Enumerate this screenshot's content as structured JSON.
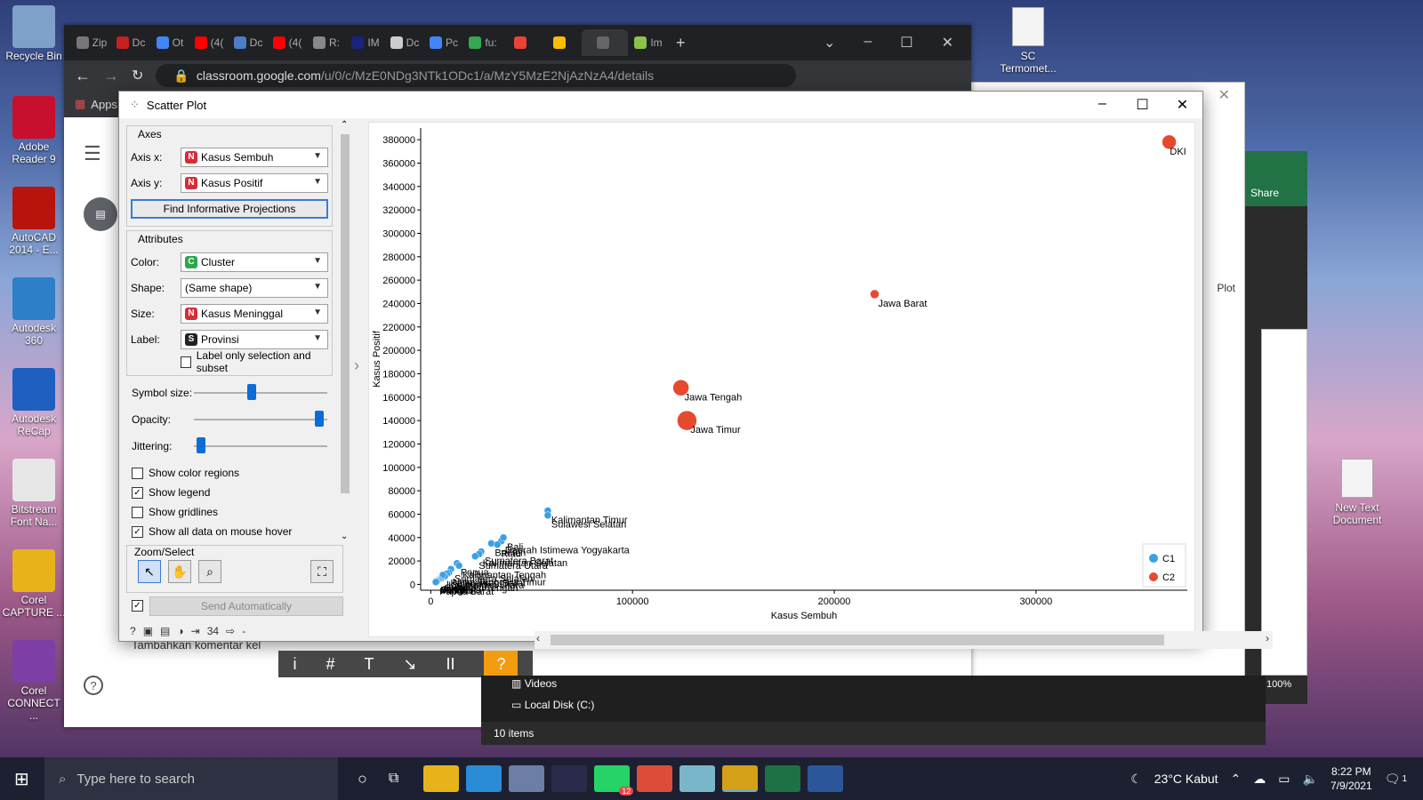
{
  "desktop_left": [
    {
      "label": "Recycle Bin",
      "top": 6,
      "color": "#7fa0c8"
    },
    {
      "label": "Adobe Reader 9",
      "top": 108,
      "color": "#c8102e"
    },
    {
      "label": "AutoCAD 2014 - E...",
      "top": 210,
      "color": "#b8140e"
    },
    {
      "label": "Autodesk 360",
      "top": 312,
      "color": "#2d7fc8"
    },
    {
      "label": "Autodesk ReCap",
      "top": 414,
      "color": "#1f5fbf"
    },
    {
      "label": "Bitstream Font Na...",
      "top": 516,
      "color": "#e6e6e6"
    },
    {
      "label": "Corel CAPTURE ...",
      "top": 618,
      "color": "#e8b31a"
    },
    {
      "label": "Corel CONNECT ...",
      "top": 720,
      "color": "#7d3fa6"
    }
  ],
  "desktop_right": {
    "sc": "SC Termomet...",
    "newtext": "New Text Document"
  },
  "browser": {
    "tabs": [
      "Zip",
      "Dc",
      "Ot",
      "(4(",
      "Dc",
      "(4(",
      "R:",
      "IM",
      "Dc",
      "Pc",
      "fu:",
      "",
      "",
      "",
      "Im"
    ],
    "url_main": "classroom.google.com",
    "url_rest": "/u/0/c/MzE0NDg3NTk1ODc1/a/MzY5MzE2NjAzNzA4/details",
    "apps": "Apps",
    "comment": "Tambahkan komentar kel"
  },
  "window": {
    "title": "Scatter Plot"
  },
  "axes": {
    "legend": "Axes",
    "x_label": "Axis x:",
    "x_value": "Kasus Sembuh",
    "y_label": "Axis y:",
    "y_value": "Kasus Positif",
    "find_button": "Find Informative Projections"
  },
  "attributes": {
    "legend": "Attributes",
    "color_label": "Color:",
    "color_value": "Cluster",
    "shape_label": "Shape:",
    "shape_value": "(Same shape)",
    "size_label": "Size:",
    "size_value": "Kasus Meninggal",
    "label_label": "Label:",
    "label_value": "Provinsi",
    "label_only": "Label only selection and subset"
  },
  "sliders": {
    "symbol_label": "Symbol size:",
    "symbol_level": 0.43,
    "opacity_label": "Opacity:",
    "opacity_level": 0.97,
    "jitter_label": "Jittering:",
    "jitter_level": 0.02
  },
  "checks": [
    {
      "label": "Show color regions",
      "checked": false
    },
    {
      "label": "Show legend",
      "checked": true
    },
    {
      "label": "Show gridlines",
      "checked": false
    },
    {
      "label": "Show all data on mouse hover",
      "checked": true
    }
  ],
  "zoom": {
    "legend": "Zoom/Select"
  },
  "send": {
    "label": "Send Automatically",
    "checked": true
  },
  "status": {
    "count": "34",
    "output": "-"
  },
  "chart_data": {
    "type": "scatter",
    "xlabel": "Kasus Sembuh",
    "ylabel": "Kasus Positif",
    "xlim": [
      -5000,
      375000
    ],
    "ylim": [
      -5000,
      390000
    ],
    "xticks": [
      "0",
      "100000",
      "200000",
      "300000"
    ],
    "yticks": [
      "0",
      "20000",
      "40000",
      "60000",
      "80000",
      "100000",
      "120000",
      "140000",
      "160000",
      "180000",
      "200000",
      "220000",
      "240000",
      "260000",
      "280000",
      "300000",
      "320000",
      "340000",
      "360000",
      "380000"
    ],
    "legend": [
      {
        "name": "C1",
        "color": "#3aa0e6"
      },
      {
        "name": "C2",
        "color": "#e64a2e"
      }
    ],
    "points": [
      {
        "label": "DKI",
        "x": 366000,
        "y": 378000,
        "cluster": "C2",
        "size": 8
      },
      {
        "label": "Jawa Barat",
        "x": 220000,
        "y": 248000,
        "cluster": "C2",
        "size": 5
      },
      {
        "label": "Jawa Tengah",
        "x": 124000,
        "y": 168000,
        "cluster": "C2",
        "size": 9
      },
      {
        "label": "Jawa Timur",
        "x": 127000,
        "y": 140000,
        "cluster": "C2",
        "size": 11
      },
      {
        "label": "Kalimantan Timur",
        "x": 58000,
        "y": 63000,
        "cluster": "C1",
        "size": 4
      },
      {
        "label": "Sulawesi Selatan",
        "x": 58000,
        "y": 59000,
        "cluster": "C1",
        "size": 4
      },
      {
        "label": "Daerah Istimewa Yogyakarta",
        "x": 35000,
        "y": 37000,
        "cluster": "C1",
        "size": 4
      },
      {
        "label": "Bali",
        "x": 36000,
        "y": 40000,
        "cluster": "C1",
        "size": 4
      },
      {
        "label": "Banten",
        "x": 30000,
        "y": 35000,
        "cluster": "C1",
        "size": 4
      },
      {
        "label": "Riau",
        "x": 33000,
        "y": 34000,
        "cluster": "C1",
        "size": 4
      },
      {
        "label": "Sumatera Barat",
        "x": 25000,
        "y": 28000,
        "cluster": "C1",
        "size": 4
      },
      {
        "label": "Kalimantan Selatan",
        "x": 24000,
        "y": 26000,
        "cluster": "C1",
        "size": 4
      },
      {
        "label": "Sumatera Utara",
        "x": 22000,
        "y": 24000,
        "cluster": "C1",
        "size": 4
      },
      {
        "label": "Papua",
        "x": 13000,
        "y": 18000,
        "cluster": "C1",
        "size": 4
      },
      {
        "label": "Kalimantan Tengah",
        "x": 14000,
        "y": 16000,
        "cluster": "C1",
        "size": 4
      },
      {
        "label": "Sumatera Selatan",
        "x": 10000,
        "y": 13000,
        "cluster": "C1",
        "size": 4
      },
      {
        "label": "Nusa Tenggara Timur",
        "x": 9000,
        "y": 10000,
        "cluster": "C1",
        "size": 4
      },
      {
        "label": "Kalimantan Barat",
        "x": 8000,
        "y": 9000,
        "cluster": "C1",
        "size": 4
      },
      {
        "label": "Kalimantan Utara",
        "x": 7000,
        "y": 7000,
        "cluster": "C1",
        "size": 4
      },
      {
        "label": "Sulawesi Tengah",
        "x": 5000,
        "y": 5000,
        "cluster": "C1",
        "size": 4
      },
      {
        "label": "Lampung",
        "x": 6000,
        "y": 8000,
        "cluster": "C1",
        "size": 4
      },
      {
        "label": "Aceh",
        "x": 4000,
        "y": 4000,
        "cluster": "C1",
        "size": 4
      },
      {
        "label": "Jambi",
        "x": 3500,
        "y": 3500,
        "cluster": "C1",
        "size": 4
      },
      {
        "label": "Bengkulu",
        "x": 3000,
        "y": 3000,
        "cluster": "C1",
        "size": 4
      },
      {
        "label": "Maluku",
        "x": 3000,
        "y": 2500,
        "cluster": "C1",
        "size": 4
      },
      {
        "label": "Papua Barat",
        "x": 2500,
        "y": 2000,
        "cluster": "C1",
        "size": 4
      }
    ]
  },
  "toolbar2": [
    "i",
    "#",
    "T",
    "↘",
    "II",
    "?"
  ],
  "explorer": {
    "items": [
      "Videos",
      "Local Disk (C:)"
    ],
    "count": "10 items",
    "zoom": "100%"
  },
  "taskbar": {
    "search": "Type here to search",
    "weather": "23°C  Kabut",
    "time": "8:22 PM",
    "date": "7/9/2021",
    "notif": "1",
    "badge": "12"
  },
  "excel_share": "Share",
  "plot_label": "Plot",
  "colors": {
    "accent": "#0a6cd6",
    "c1": "#3aa0e6",
    "c2": "#e64a2e"
  }
}
